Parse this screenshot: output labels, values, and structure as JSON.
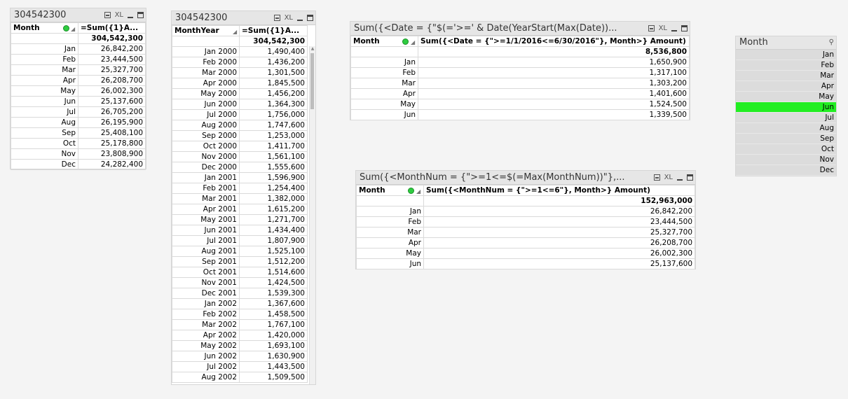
{
  "box1": {
    "title": "304542300",
    "col_dim": "Month",
    "col_expr": "=Sum({1}A...",
    "total": "304,542,300",
    "rows": [
      {
        "m": "Jan",
        "v": "26,842,200"
      },
      {
        "m": "Feb",
        "v": "23,444,500"
      },
      {
        "m": "Mar",
        "v": "25,327,700"
      },
      {
        "m": "Apr",
        "v": "26,208,700"
      },
      {
        "m": "May",
        "v": "26,002,300"
      },
      {
        "m": "Jun",
        "v": "25,137,600"
      },
      {
        "m": "Jul",
        "v": "26,705,200"
      },
      {
        "m": "Aug",
        "v": "26,195,900"
      },
      {
        "m": "Sep",
        "v": "25,408,100"
      },
      {
        "m": "Oct",
        "v": "25,178,800"
      },
      {
        "m": "Nov",
        "v": "23,808,900"
      },
      {
        "m": "Dec",
        "v": "24,282,400"
      }
    ]
  },
  "box2": {
    "title": "304542300",
    "col_dim": "MonthYear",
    "col_expr": "=Sum({1}A...",
    "total": "304,542,300",
    "rows": [
      {
        "m": "Jan 2000",
        "v": "1,490,400"
      },
      {
        "m": "Feb 2000",
        "v": "1,436,200"
      },
      {
        "m": "Mar 2000",
        "v": "1,301,500"
      },
      {
        "m": "Apr 2000",
        "v": "1,845,500"
      },
      {
        "m": "May 2000",
        "v": "1,456,200"
      },
      {
        "m": "Jun 2000",
        "v": "1,364,300"
      },
      {
        "m": "Jul 2000",
        "v": "1,756,000"
      },
      {
        "m": "Aug 2000",
        "v": "1,747,600"
      },
      {
        "m": "Sep 2000",
        "v": "1,253,000"
      },
      {
        "m": "Oct 2000",
        "v": "1,411,700"
      },
      {
        "m": "Nov 2000",
        "v": "1,561,100"
      },
      {
        "m": "Dec 2000",
        "v": "1,555,600"
      },
      {
        "m": "Jan 2001",
        "v": "1,596,900"
      },
      {
        "m": "Feb 2001",
        "v": "1,254,400"
      },
      {
        "m": "Mar 2001",
        "v": "1,382,000"
      },
      {
        "m": "Apr 2001",
        "v": "1,615,200"
      },
      {
        "m": "May 2001",
        "v": "1,271,700"
      },
      {
        "m": "Jun 2001",
        "v": "1,434,400"
      },
      {
        "m": "Jul 2001",
        "v": "1,807,900"
      },
      {
        "m": "Aug 2001",
        "v": "1,525,100"
      },
      {
        "m": "Sep 2001",
        "v": "1,512,200"
      },
      {
        "m": "Oct 2001",
        "v": "1,514,600"
      },
      {
        "m": "Nov 2001",
        "v": "1,424,500"
      },
      {
        "m": "Dec 2001",
        "v": "1,539,300"
      },
      {
        "m": "Jan 2002",
        "v": "1,367,600"
      },
      {
        "m": "Feb 2002",
        "v": "1,458,500"
      },
      {
        "m": "Mar 2002",
        "v": "1,767,100"
      },
      {
        "m": "Apr 2002",
        "v": "1,420,000"
      },
      {
        "m": "May 2002",
        "v": "1,693,100"
      },
      {
        "m": "Jun 2002",
        "v": "1,630,900"
      },
      {
        "m": "Jul 2002",
        "v": "1,443,500"
      },
      {
        "m": "Aug 2002",
        "v": "1,509,500"
      }
    ]
  },
  "box3": {
    "title": "Sum({<Date = {\"$(='>=' & Date(YearStart(Max(Date))...",
    "col_dim": "Month",
    "col_expr": "Sum({<Date = {\">=1/1/2016<=6/30/2016\"}, Month>} Amount)",
    "total": "8,536,800",
    "rows": [
      {
        "m": "Jan",
        "v": "1,650,900"
      },
      {
        "m": "Feb",
        "v": "1,317,100"
      },
      {
        "m": "Mar",
        "v": "1,303,200"
      },
      {
        "m": "Apr",
        "v": "1,401,600"
      },
      {
        "m": "May",
        "v": "1,524,500"
      },
      {
        "m": "Jun",
        "v": "1,339,500"
      }
    ]
  },
  "box4": {
    "title": "Sum({<MonthNum = {\">=1<=$(=Max(MonthNum))\"},...",
    "col_dim": "Month",
    "col_expr": "Sum({<MonthNum = {\">=1<=6\"}, Month>} Amount)",
    "total": "152,963,000",
    "rows": [
      {
        "m": "Jan",
        "v": "26,842,200"
      },
      {
        "m": "Feb",
        "v": "23,444,500"
      },
      {
        "m": "Mar",
        "v": "25,327,700"
      },
      {
        "m": "Apr",
        "v": "26,208,700"
      },
      {
        "m": "May",
        "v": "26,002,300"
      },
      {
        "m": "Jun",
        "v": "25,137,600"
      }
    ]
  },
  "listbox": {
    "title": "Month",
    "items": [
      "Jan",
      "Feb",
      "Mar",
      "Apr",
      "May",
      "Jun",
      "Jul",
      "Aug",
      "Sep",
      "Oct",
      "Nov",
      "Dec"
    ],
    "selected": "Jun",
    "selected_color": "#22ee22"
  },
  "icons": {
    "xl_label": "XL"
  }
}
